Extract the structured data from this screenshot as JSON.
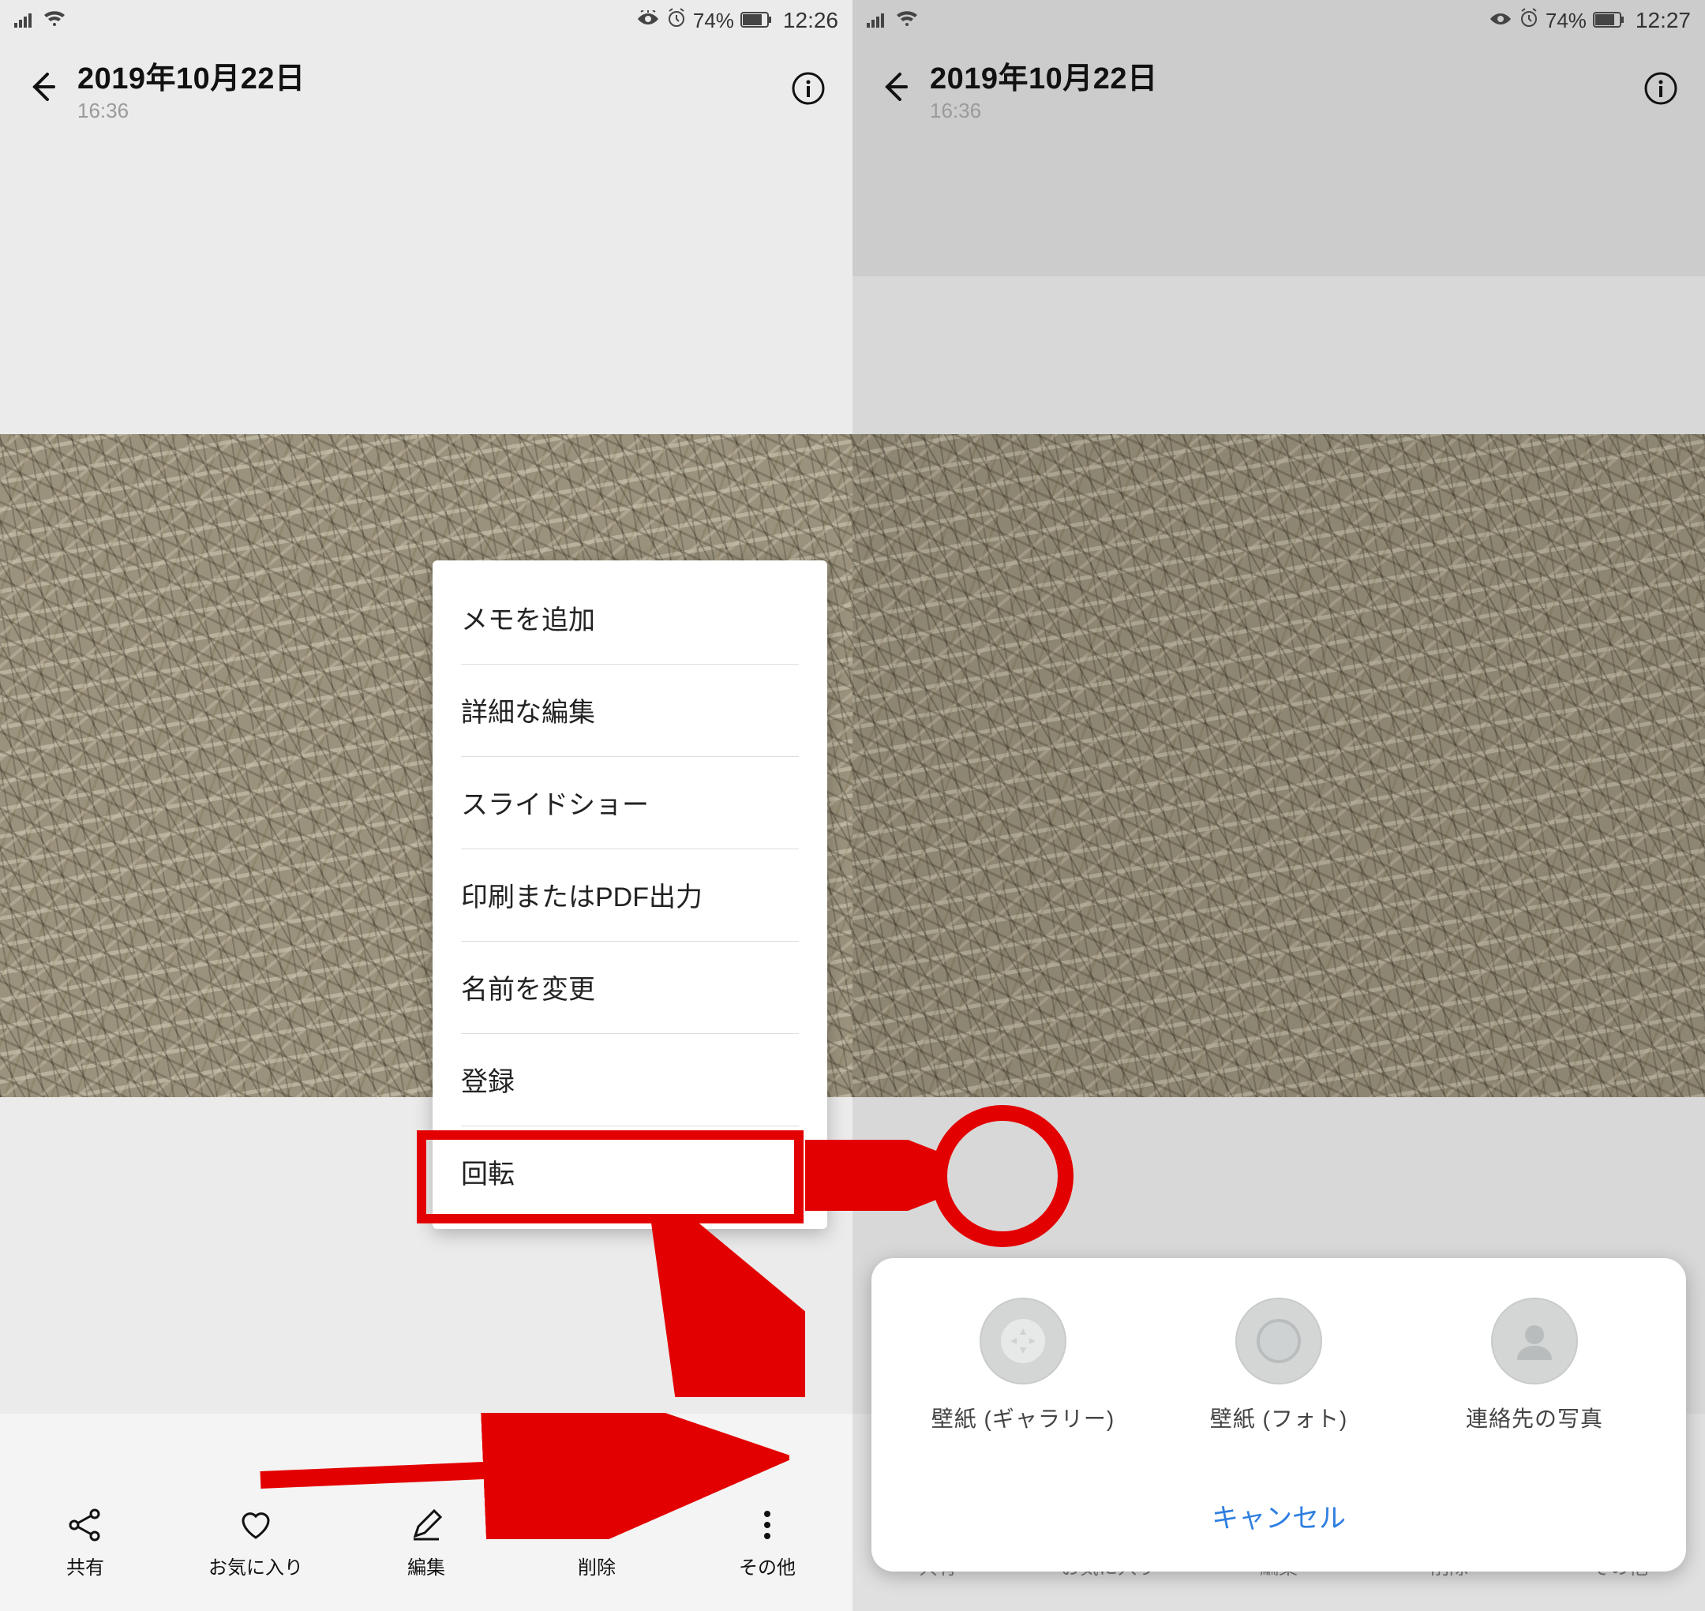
{
  "left": {
    "status": {
      "battery": "74%",
      "time": "12:26"
    },
    "header": {
      "date": "2019年10月22日",
      "time": "16:36"
    },
    "popup": {
      "items": [
        "メモを追加",
        "詳細な編集",
        "スライドショー",
        "印刷またはPDF出力",
        "名前を変更",
        "登録",
        "回転"
      ]
    },
    "toolbar": {
      "share": "共有",
      "favorite": "お気に入り",
      "edit": "編集",
      "delete": "削除",
      "more": "その他"
    }
  },
  "right": {
    "status": {
      "battery": "74%",
      "time": "12:27"
    },
    "header": {
      "date": "2019年10月22日",
      "time": "16:36"
    },
    "sheet": {
      "opt1": "壁紙 (ギャラリー)",
      "opt2": "壁紙 (フォト)",
      "opt3": "連絡先の写真",
      "cancel": "キャンセル"
    },
    "toolbar": {
      "share": "共有",
      "favorite": "お気に入り",
      "edit": "編集",
      "delete": "削除",
      "more": "その他"
    }
  }
}
